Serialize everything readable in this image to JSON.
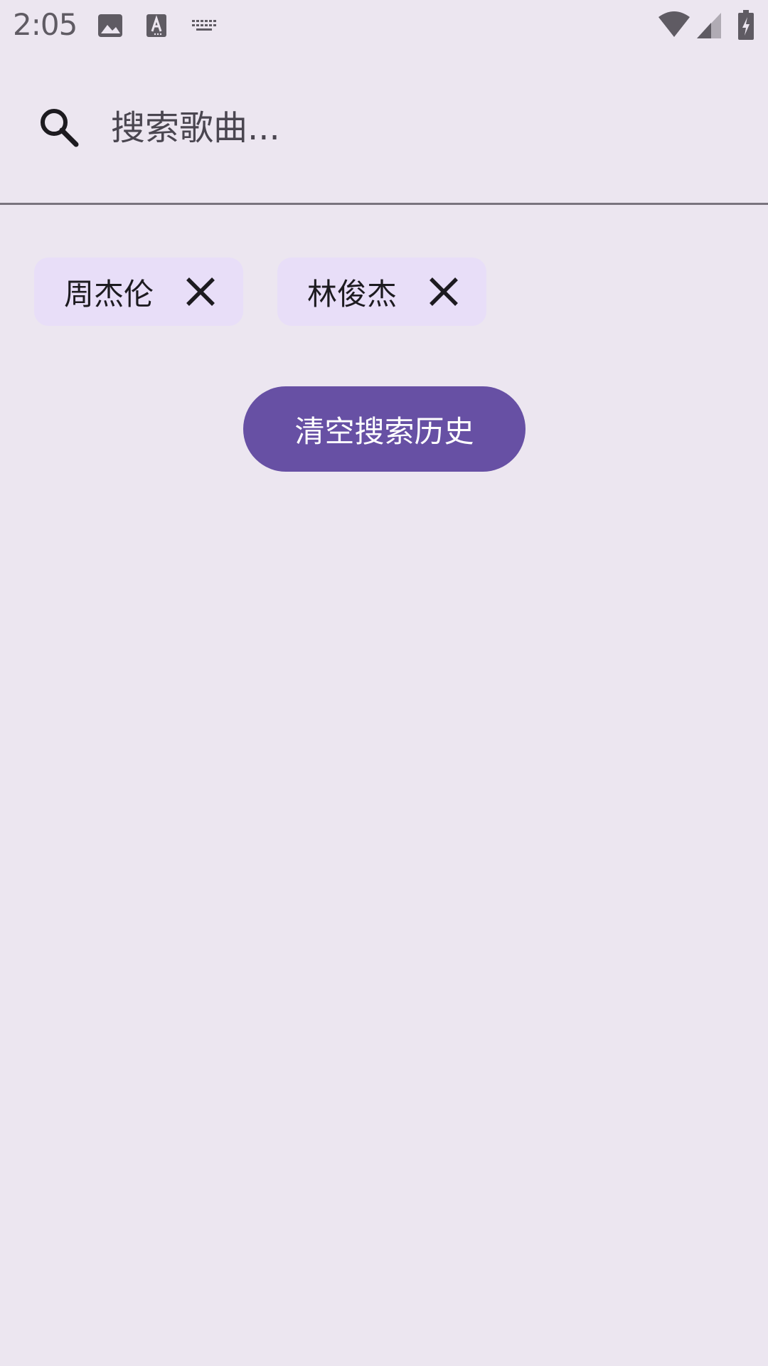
{
  "status_bar": {
    "time": "2:05",
    "icons": [
      "image-icon",
      "text-a-icon",
      "keyboard-icon",
      "wifi-icon",
      "cellular-signal-icon",
      "battery-charging-icon"
    ]
  },
  "search": {
    "placeholder": "搜索歌曲...",
    "value": "",
    "icon": "search-icon"
  },
  "history": {
    "chips": [
      {
        "label": "周杰伦",
        "icon": "close-icon"
      },
      {
        "label": "林俊杰",
        "icon": "close-icon"
      }
    ],
    "clear_label": "清空搜索历史"
  },
  "colors": {
    "background": "#ece6f0",
    "chip_background": "#e8def8",
    "primary": "#6750a4",
    "text": "#1d1b20"
  }
}
